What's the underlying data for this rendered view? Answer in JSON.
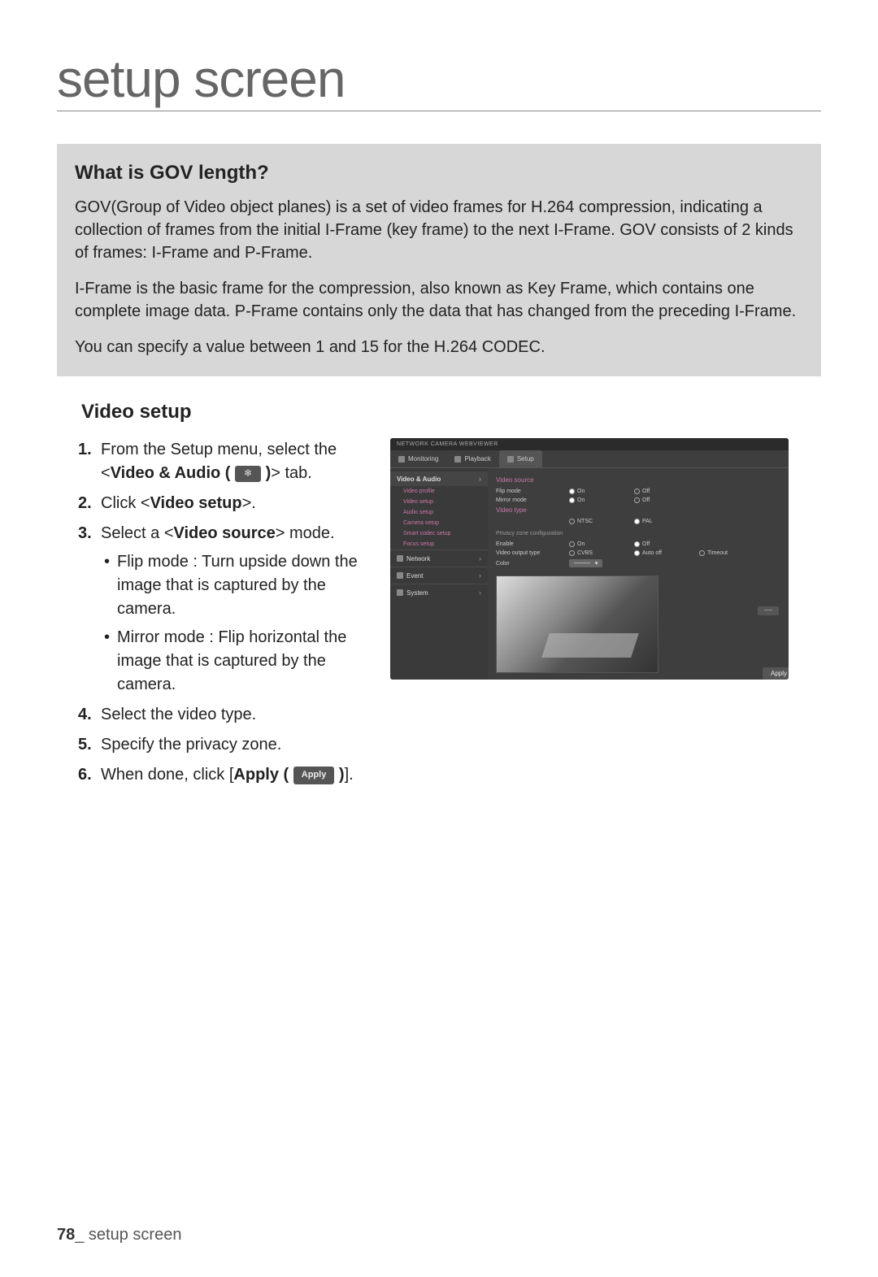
{
  "title": "setup screen",
  "info_box": {
    "heading": "What is GOV length?",
    "p1": "GOV(Group of Video object planes) is a set of video frames for H.264 compression, indicating a collection of frames from the initial I-Frame (key frame) to the next I-Frame. GOV consists of 2 kinds of frames: I-Frame and P-Frame.",
    "p2": "I-Frame is the basic frame for the compression, also known as Key Frame, which contains one complete image data. P-Frame contains only the data that has changed from the preceding I-Frame.",
    "p3": "You can specify a value between 1 and 15 for the H.264 CODEC."
  },
  "section_heading": "Video setup",
  "steps": {
    "s1a": "From the Setup menu, select the <",
    "s1b": "Video & Audio (",
    "s1c": ")",
    "s1d": "> tab.",
    "s2a": "Click <",
    "s2b": "Video setup",
    "s2c": ">.",
    "s3a": "Select a <",
    "s3b": "Video source",
    "s3c": "> mode.",
    "bullet1": "Flip mode : Turn upside down the image that is captured by the camera.",
    "bullet2": "Mirror mode : Flip horizontal the image that is captured by the camera.",
    "s4": "Select the video type.",
    "s5": "Specify the privacy zone.",
    "s6a": "When done, click [",
    "s6b": "Apply (",
    "s6c": ")",
    "s6d": "].",
    "apply_chip": "Apply"
  },
  "ss": {
    "topbar": "NETWORK CAMERA WEBVIEWER",
    "tabs": {
      "monitoring": "Monitoring",
      "playback": "Playback",
      "setup": "Setup"
    },
    "sidebar": {
      "group1": "Video & Audio",
      "items": {
        "i1": "Video profile",
        "i2": "Video setup",
        "i3": "Audio setup",
        "i4": "Camera setup",
        "i5": "Smart codec setup",
        "i6": "Focus setup"
      },
      "group2": "Network",
      "group3": "Event",
      "group4": "System"
    },
    "main": {
      "section1": "Video source",
      "flip_label": "Flip mode",
      "mirror_label": "Mirror mode",
      "on": "On",
      "off": "Off",
      "section2": "Video type",
      "ntsc": "NTSC",
      "pal": "PAL",
      "divider": "Privacy zone configuration",
      "enable": "Enable",
      "videooutput": "Video output type",
      "cvbs": "CVBS",
      "autooff": "Auto off",
      "timeout": "Timeout",
      "color": "Color",
      "apply": "Apply"
    }
  },
  "footer": {
    "page": "78",
    "label": "_ setup screen"
  }
}
